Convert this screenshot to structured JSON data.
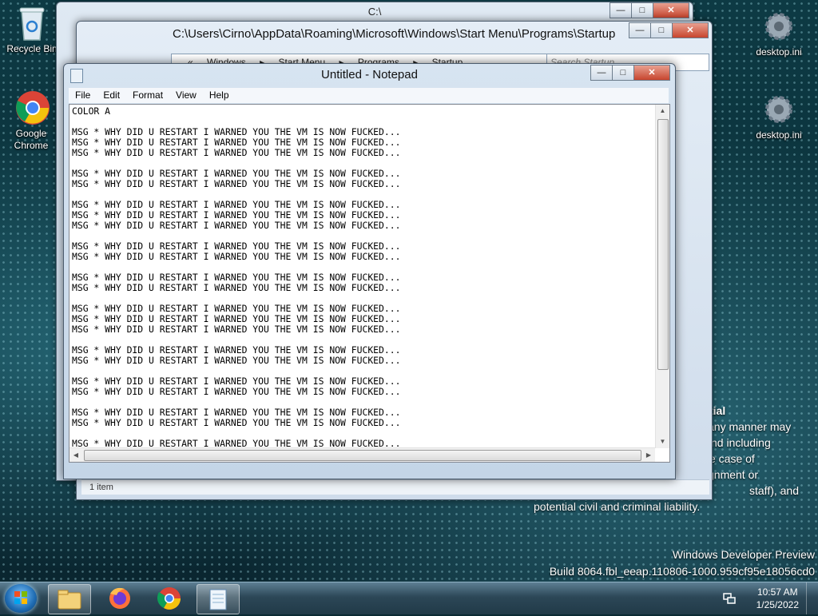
{
  "desktop": {
    "icons": [
      {
        "label": "Recycle Bin",
        "icon": "recycle-bin-icon"
      },
      {
        "label": "Google Chrome",
        "label_line1": "Google",
        "label_line2": "Chrome",
        "icon": "chrome-icon"
      },
      {
        "label": "desktop.ini",
        "icon": "settings-file-icon"
      },
      {
        "label": "desktop.ini",
        "icon": "settings-file-icon"
      }
    ],
    "legal_text": {
      "line1": "tial",
      "line2": "any manner may",
      "line3": "nd including",
      "line4": "e case of",
      "line5": "gnment or",
      "line6": "staff), and",
      "line7": "potential civil and criminal liability."
    },
    "build_info": {
      "line1": "Windows Developer Preview",
      "line2": "Build 8064.fbl_eeap.110806-1000.959cf95e18056cd0"
    }
  },
  "explorer_back": {
    "title": "C:\\"
  },
  "explorer": {
    "title": "C:\\Users\\Cirno\\AppData\\Roaming\\Microsoft\\Windows\\Start Menu\\Programs\\Startup",
    "breadcrumb": [
      "«",
      "Windows",
      "▸",
      "Start Menu",
      "▸",
      "Programs",
      "▸",
      "Startup"
    ],
    "search_placeholder": "Search Startup",
    "status": "1 item"
  },
  "notepad": {
    "title": "Untitled - Notepad",
    "menu": [
      "File",
      "Edit",
      "Format",
      "View",
      "Help"
    ],
    "content": "COLOR A\n\nMSG * WHY DID U RESTART I WARNED YOU THE VM IS NOW FUCKED...\nMSG * WHY DID U RESTART I WARNED YOU THE VM IS NOW FUCKED...\nMSG * WHY DID U RESTART I WARNED YOU THE VM IS NOW FUCKED...\n\nMSG * WHY DID U RESTART I WARNED YOU THE VM IS NOW FUCKED...\nMSG * WHY DID U RESTART I WARNED YOU THE VM IS NOW FUCKED...\n\nMSG * WHY DID U RESTART I WARNED YOU THE VM IS NOW FUCKED...\nMSG * WHY DID U RESTART I WARNED YOU THE VM IS NOW FUCKED...\nMSG * WHY DID U RESTART I WARNED YOU THE VM IS NOW FUCKED...\n\nMSG * WHY DID U RESTART I WARNED YOU THE VM IS NOW FUCKED...\nMSG * WHY DID U RESTART I WARNED YOU THE VM IS NOW FUCKED...\n\nMSG * WHY DID U RESTART I WARNED YOU THE VM IS NOW FUCKED...\nMSG * WHY DID U RESTART I WARNED YOU THE VM IS NOW FUCKED...\n\nMSG * WHY DID U RESTART I WARNED YOU THE VM IS NOW FUCKED...\nMSG * WHY DID U RESTART I WARNED YOU THE VM IS NOW FUCKED...\nMSG * WHY DID U RESTART I WARNED YOU THE VM IS NOW FUCKED...\n\nMSG * WHY DID U RESTART I WARNED YOU THE VM IS NOW FUCKED...\nMSG * WHY DID U RESTART I WARNED YOU THE VM IS NOW FUCKED...\n\nMSG * WHY DID U RESTART I WARNED YOU THE VM IS NOW FUCKED...\nMSG * WHY DID U RESTART I WARNED YOU THE VM IS NOW FUCKED...\n\nMSG * WHY DID U RESTART I WARNED YOU THE VM IS NOW FUCKED...\nMSG * WHY DID U RESTART I WARNED YOU THE VM IS NOW FUCKED...\n\nMSG * WHY DID U RESTART I WARNED YOU THE VM IS NOW FUCKED...\nMSG * WHY DID U RESTART I WARNED YOU THE VM IS NOW FUCKED..."
  },
  "taskbar": {
    "pinned": [
      "file-explorer-icon",
      "firefox-icon",
      "chrome-icon",
      "notepad-icon"
    ],
    "clock_time": "10:57 AM",
    "clock_date": "1/25/2022"
  },
  "colors": {
    "title_bar": "#c4d5e7",
    "close_button": "#c7452e",
    "taskbar": "#2c4757"
  }
}
